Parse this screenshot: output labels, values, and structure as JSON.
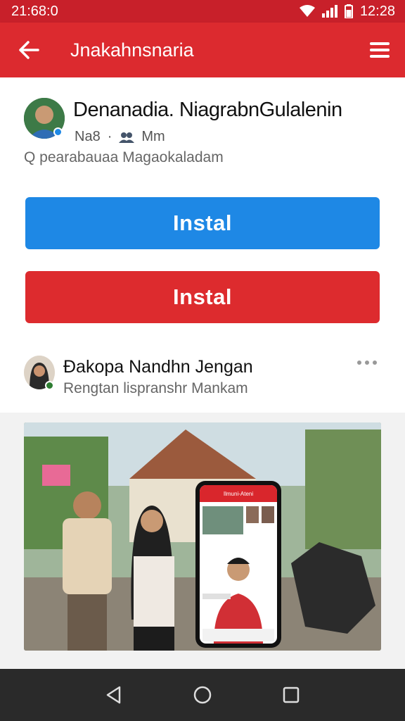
{
  "status_bar": {
    "time_left": "21:68:0",
    "time_right": "12:28"
  },
  "app_bar": {
    "title": "Jnakahnsnaria",
    "back_icon": "arrow-left-icon",
    "menu_icon": "menu-icon"
  },
  "post": {
    "author_name": "Denanadia. NiagrabnGulalenin",
    "meta_left": "Na8",
    "meta_right": "Mm",
    "subtitle": "Q pearabauaa Magaokaladam"
  },
  "buttons": {
    "install_primary": "Instal",
    "install_secondary": "Instal"
  },
  "second_post": {
    "author_name": "Đakopa Nandhn Jengan",
    "subtitle": "Rengtan lispranshr Mankam"
  },
  "phone_screen": {
    "header": "Ilmuni-Ateni"
  },
  "colors": {
    "brand_red": "#dc2a2f",
    "button_blue": "#1e88e5",
    "button_red": "#dd2b2e"
  },
  "nav_bar": {
    "back_icon": "triangle-back-icon",
    "home_icon": "circle-home-icon",
    "recents_icon": "square-recents-icon"
  }
}
